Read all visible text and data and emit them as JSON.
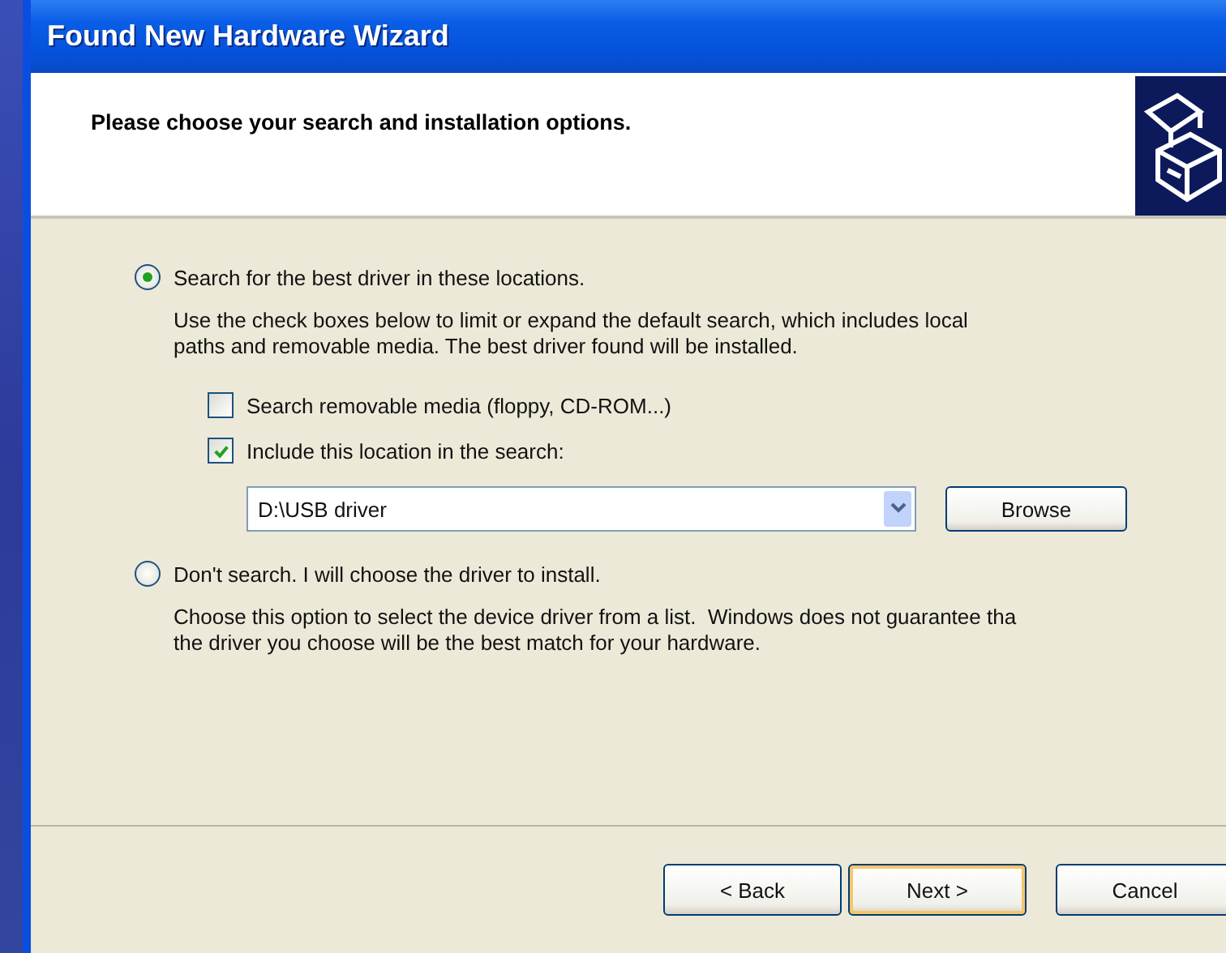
{
  "window": {
    "title": "Found New Hardware Wizard"
  },
  "header": {
    "title": "Please choose your search and installation options."
  },
  "options": [
    {
      "label": "Search for the best driver in these locations.",
      "selected": true,
      "description_lines": [
        "Use the check boxes below to limit or expand the default search, which includes local",
        "paths and removable media. The best driver found will be installed."
      ],
      "checkboxes": [
        {
          "label": "Search removable media (floppy, CD-ROM...)",
          "checked": false
        },
        {
          "label": "Include this location in the search:",
          "checked": true
        }
      ],
      "location": {
        "value": "D:\\USB driver",
        "button": "Browse"
      }
    },
    {
      "label": "Don't search. I will choose the driver to install.",
      "selected": false,
      "description_lines": [
        "Choose this option to select the device driver from a list.  Windows does not guarantee tha",
        "the driver you choose will be the best match for your hardware."
      ]
    }
  ],
  "buttons": [
    {
      "label": "< Back",
      "default": false
    },
    {
      "label": "Next >",
      "default": true
    },
    {
      "label": "Cancel",
      "default": false
    }
  ]
}
